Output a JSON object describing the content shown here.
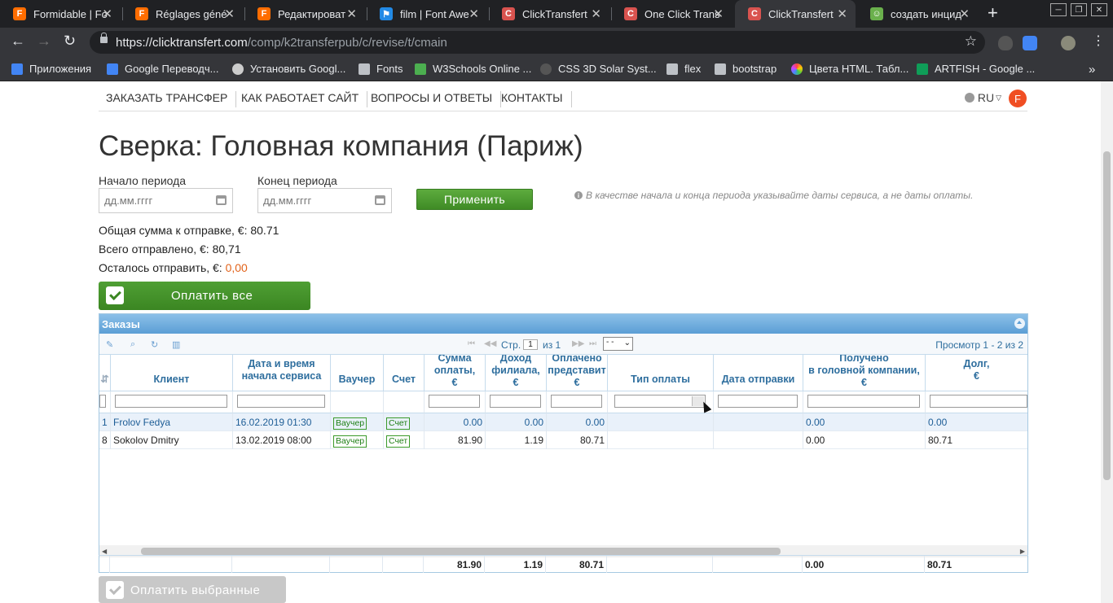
{
  "browser": {
    "tabs": [
      {
        "title": "Formidable | Fo",
        "favicon_color": "#ff6d00",
        "glyph": "F"
      },
      {
        "title": "Réglages géné",
        "favicon_color": "#ff6d00",
        "glyph": "F"
      },
      {
        "title": "Редактироват",
        "favicon_color": "#ff6d00",
        "glyph": "F"
      },
      {
        "title": "film | Font Awe",
        "favicon_color": "#228ae6",
        "glyph": "⚑"
      },
      {
        "title": "ClickTransfert",
        "favicon_color": "#d9534f",
        "glyph": "C"
      },
      {
        "title": "One Click Trans",
        "favicon_color": "#d9534f",
        "glyph": "C"
      },
      {
        "title": "ClickTransfert",
        "favicon_color": "#d9534f",
        "glyph": "C"
      },
      {
        "title": "создать инцид",
        "favicon_color": "#6ab04c",
        "glyph": "☺"
      }
    ],
    "url_host": "https://clicktransfert.com",
    "url_path": "/comp/k2transferpub/c/revise/t/cmain",
    "bookmarks": [
      {
        "label": "Приложения",
        "icon": "apps-grid-icon"
      },
      {
        "label": "Google Переводч...",
        "icon": "google-translate-icon"
      },
      {
        "label": "Установить Googl...",
        "icon": "linux-icon"
      },
      {
        "label": "Fonts",
        "icon": "folder-icon"
      },
      {
        "label": "W3Schools Online ...",
        "icon": "w3schools-icon"
      },
      {
        "label": "CSS 3D Solar Syst...",
        "icon": "codepen-icon"
      },
      {
        "label": "flex",
        "icon": "folder-icon"
      },
      {
        "label": "bootstrap",
        "icon": "folder-icon"
      },
      {
        "label": "Цвета HTML. Табл...",
        "icon": "color-wheel-icon"
      },
      {
        "label": "ARTFISH - Google ...",
        "icon": "green-plus-icon"
      }
    ],
    "more_bookmarks": "»"
  },
  "site": {
    "nav": [
      "ЗАКАЗАТЬ ТРАНСФЕР",
      "КАК РАБОТАЕТ САЙТ",
      "ВОПРОСЫ И ОТВЕТЫ",
      "КОНТАКТЫ"
    ],
    "lang": "RU",
    "user_initial": "F"
  },
  "page": {
    "title": "Сверка: Головная компания (Париж)",
    "start_label": "Начало периода",
    "end_label": "Конец периода",
    "date_placeholder": "дд.мм.гггг",
    "apply": "Применить",
    "hint": "В качестве начала и конца периода указывайте даты сервиса, а не даты оплаты.",
    "total_to_send": "Общая сумма к отправке, €: 80.71",
    "total_sent": "Всего отправлено, €: 80,71",
    "remaining_label": "Осталось отправить, €: ",
    "remaining_value": "0,00",
    "pay_all": "Оплатить все",
    "pay_selected": "Оплатить выбранные"
  },
  "grid": {
    "caption": "Заказы",
    "pager": {
      "page_label": "Стр.",
      "page": "1",
      "of": "из 1",
      "rows_select": "- -",
      "view": "Просмотр 1 - 2 из 2"
    },
    "columns": {
      "client": "Клиент",
      "datetime_1": "Дата и время",
      "datetime_2": "начала сервиса",
      "voucher": "Ваучер",
      "invoice": "Счет",
      "sum_1": "Сумма",
      "sum_2": "оплаты,",
      "sum_3": "€",
      "income_1": "Доход",
      "income_2": "филиала,",
      "income_3": "€",
      "paid_1": "Оплачено",
      "paid_2": "представит",
      "paid_3": "€",
      "paytype": "Тип оплаты",
      "sentdate": "Дата отправки",
      "received_1": "Получено",
      "received_2": "в головной компании,",
      "received_3": "€",
      "debt_1": "Долг,",
      "debt_2": "€"
    },
    "rows": [
      {
        "id": "1",
        "client": "Frolov Fedya",
        "datetime": "16.02.2019 01:30",
        "voucher": "Ваучер",
        "invoice": "Счет",
        "sum": "0.00",
        "income": "0.00",
        "paid": "0.00",
        "paytype": "",
        "sentdate": "",
        "received": "0.00",
        "debt": "0.00"
      },
      {
        "id": "8",
        "client": "Sokolov Dmitry",
        "datetime": "13.02.2019 08:00",
        "voucher": "Ваучер",
        "invoice": "Счет",
        "sum": "81.90",
        "income": "1.19",
        "paid": "80.71",
        "paytype": "",
        "sentdate": "",
        "received": "0.00",
        "debt": "80.71"
      }
    ],
    "footer": {
      "sum": "81.90",
      "income": "1.19",
      "paid": "80.71",
      "received": "0.00",
      "debt": "80.71"
    }
  }
}
